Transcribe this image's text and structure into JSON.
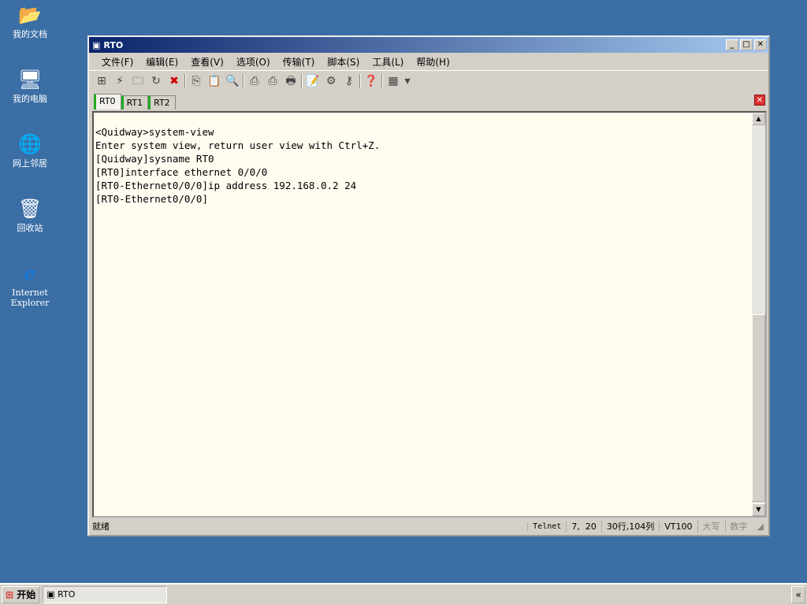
{
  "desktop": {
    "icons": [
      "我的文档",
      "我的电脑",
      "网上邻居",
      "回收站",
      "Internet Explorer"
    ]
  },
  "window": {
    "title": "RTO",
    "menu": [
      "文件(F)",
      "编辑(E)",
      "查看(V)",
      "选项(O)",
      "传输(T)",
      "脚本(S)",
      "工具(L)",
      "帮助(H)"
    ],
    "tabs": [
      "RT0",
      "RT1",
      "RT2"
    ],
    "terminal": [
      "<Quidway>system-view",
      "Enter system view, return user view with Ctrl+Z.",
      "[Quidway]sysname RT0",
      "[RT0]interface ethernet 0/0/0",
      "[RT0-Ethernet0/0/0]ip address 192.168.0.2 24",
      "[RT0-Ethernet0/0/0]"
    ],
    "status": {
      "ready": "就绪",
      "protocol": "Telnet",
      "cursor": "7,  20",
      "size": "30行,104列",
      "emulation": "VT100",
      "caps": "大写",
      "num": "数字"
    }
  },
  "taskbar": {
    "start": "开始",
    "task": "RTO",
    "tray": "«"
  }
}
